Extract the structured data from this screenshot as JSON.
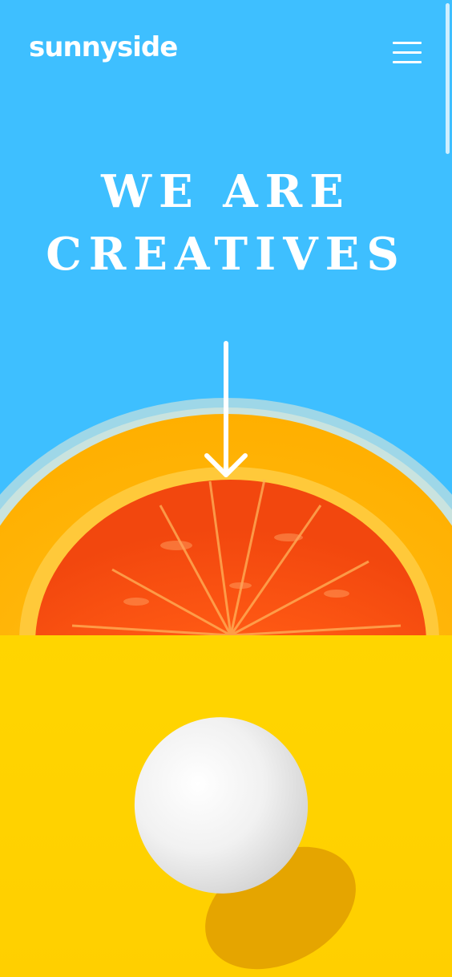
{
  "header": {
    "logo_text": "sunnyside",
    "menu_icon": "hamburger-menu-icon"
  },
  "hero": {
    "title_line1": "WE ARE",
    "title_line2": "CREATIVES",
    "arrow_icon": "arrow-down-icon"
  },
  "images": {
    "hero_image": "orange-in-bowl",
    "egg_image": "white-egg-on-yellow"
  },
  "colors": {
    "sky_blue": "#3EBFFF",
    "yellow": "#FFD400",
    "orange": "#FF5A14",
    "white": "#FFFFFF"
  }
}
